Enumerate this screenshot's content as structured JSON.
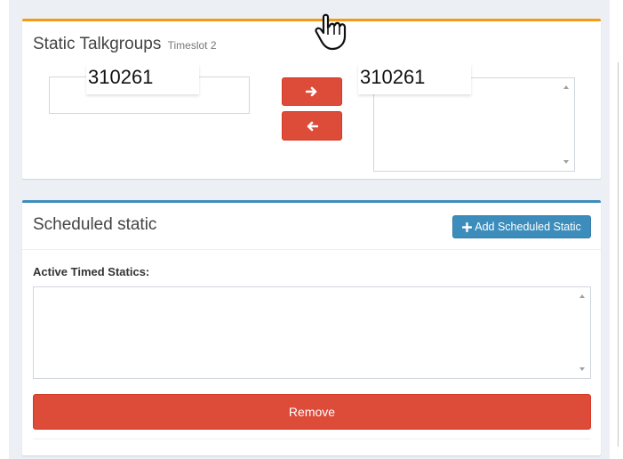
{
  "static_talkgroups": {
    "title": "Static Talkgroups",
    "timeslot": "Timeslot 2",
    "available_value": "310261",
    "selected_value": "310261",
    "move_right_icon": "arrow-right-icon",
    "move_left_icon": "arrow-left-icon",
    "accent_color": "#f39c12"
  },
  "scheduled_static": {
    "title": "Scheduled static",
    "add_button_icon": "plus-icon",
    "add_button_label": "Add Scheduled Static",
    "active_label": "Active Timed Statics:",
    "remove_label": "Remove",
    "accent_color": "#3c8dbc"
  },
  "cursor_icon": "hand-pointer-icon"
}
